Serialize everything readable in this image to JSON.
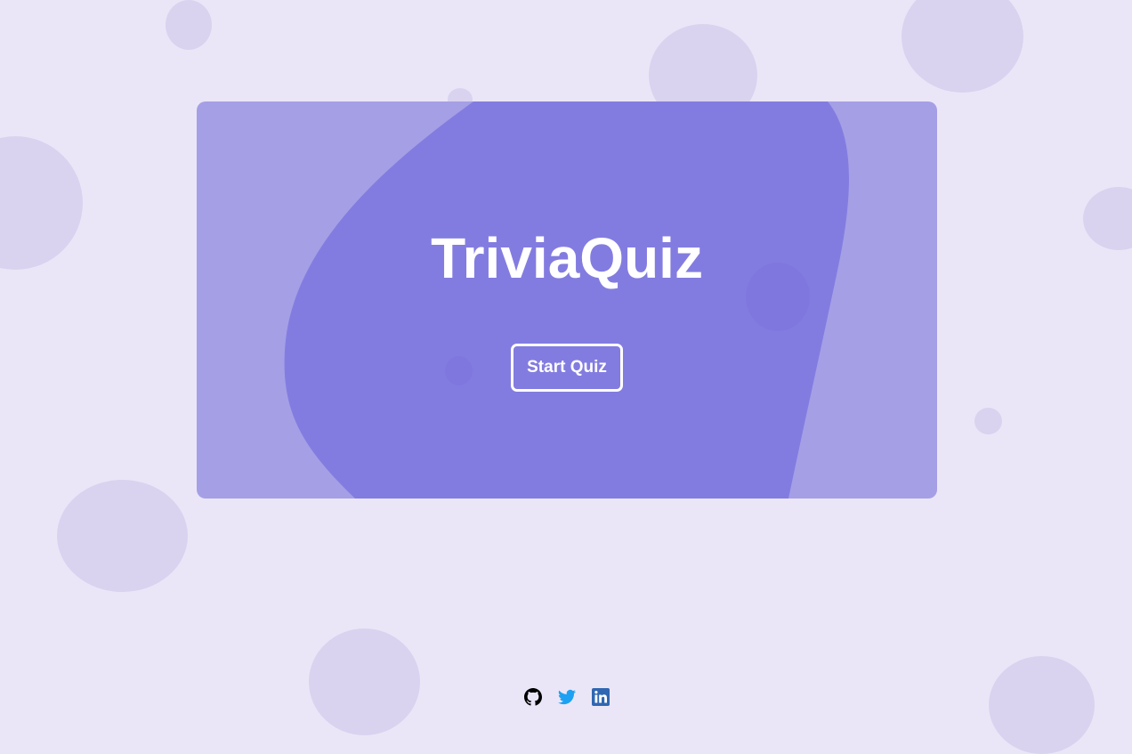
{
  "app": {
    "title": "TriviaQuiz"
  },
  "hero": {
    "title": "TriviaQuiz",
    "start_button_label": "Start Quiz"
  },
  "social_links": [
    {
      "name": "github",
      "icon": "github-icon",
      "color": "#000000"
    },
    {
      "name": "twitter",
      "icon": "twitter-icon",
      "color": "#1da1f2"
    },
    {
      "name": "linkedin",
      "icon": "linkedin-icon",
      "color": "#2f67b2"
    }
  ],
  "colors": {
    "page_background": "#ebe6f7",
    "bubble": "#d9d3f0",
    "card_background": "#a59fe6",
    "card_blob": "#837ce0",
    "text": "#ffffff"
  }
}
